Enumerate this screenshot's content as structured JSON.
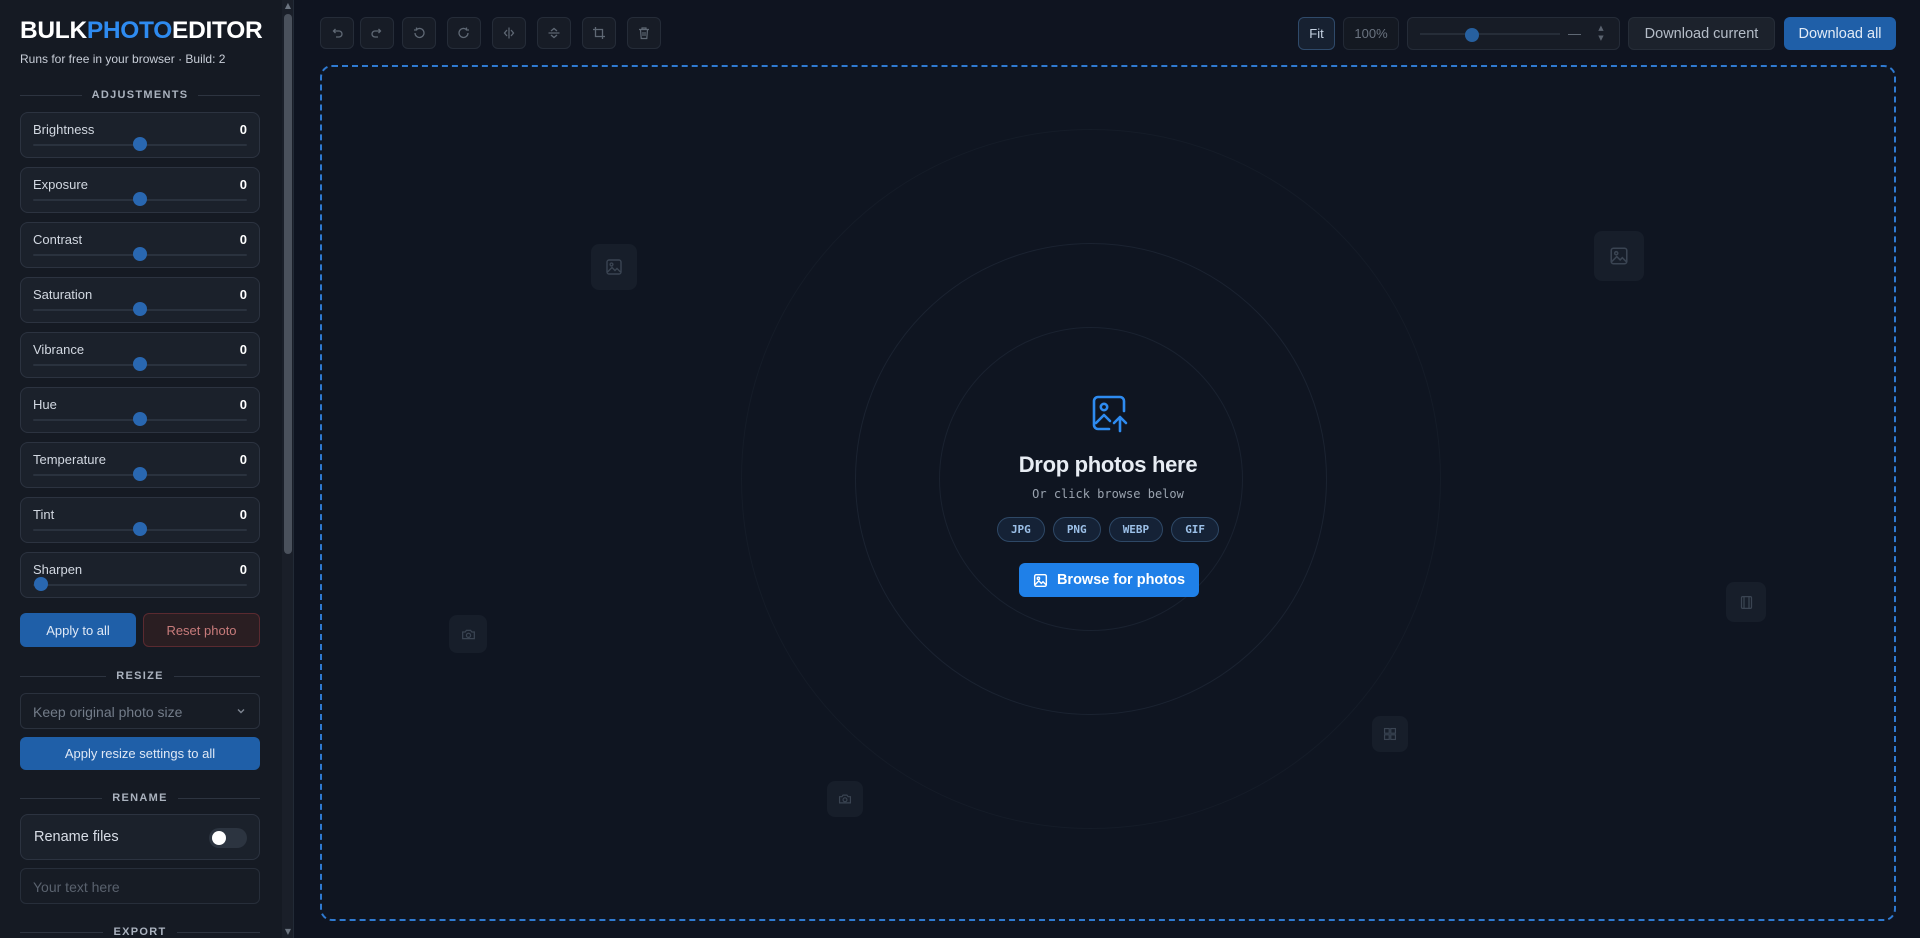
{
  "brand": {
    "part1": "BULK",
    "part2": "PHOTO",
    "part3": "EDITOR",
    "tagline": "Runs for free in your browser · Build: 2"
  },
  "sections": {
    "adjustments": "ADJUSTMENTS",
    "resize": "RESIZE",
    "rename": "RENAME",
    "export": "EXPORT"
  },
  "adjustments": [
    {
      "label": "Brightness",
      "value": "0",
      "level": 0.5
    },
    {
      "label": "Exposure",
      "value": "0",
      "level": 0.5
    },
    {
      "label": "Contrast",
      "value": "0",
      "level": 0.5
    },
    {
      "label": "Saturation",
      "value": "0",
      "level": 0.5
    },
    {
      "label": "Vibrance",
      "value": "0",
      "level": 0.5
    },
    {
      "label": "Hue",
      "value": "0",
      "level": 0.5
    },
    {
      "label": "Temperature",
      "value": "0",
      "level": 0.5
    },
    {
      "label": "Tint",
      "value": "0",
      "level": 0.5
    },
    {
      "label": "Sharpen",
      "value": "0",
      "level": 0.0
    }
  ],
  "actions": {
    "apply_all": "Apply to all",
    "reset": "Reset photo"
  },
  "resize": {
    "selected": "Keep original photo size",
    "apply": "Apply resize settings to all"
  },
  "rename": {
    "toggle_label": "Rename files",
    "enabled": false,
    "input_placeholder": "Your text here"
  },
  "toolbar": {
    "fit": "Fit",
    "zoom_percent": "100%",
    "zoom_value": "—",
    "download_current": "Download current",
    "download_all": "Download all",
    "tools": [
      "undo-icon",
      "redo-icon",
      "rotate-left-icon",
      "rotate-right-icon",
      "flip-horizontal-icon",
      "flip-vertical-icon",
      "crop-icon",
      "delete-icon"
    ]
  },
  "dropzone": {
    "title": "Drop photos here",
    "subtitle": "Or click browse below",
    "formats": [
      "JPG",
      "PNG",
      "WEBP",
      "GIF"
    ],
    "browse": "Browse for photos"
  },
  "colors": {
    "accent": "#1f80e8",
    "brand_blue": "#2e8bf0",
    "dashed_border": "#2f7ad1",
    "background": "#0f1420"
  }
}
